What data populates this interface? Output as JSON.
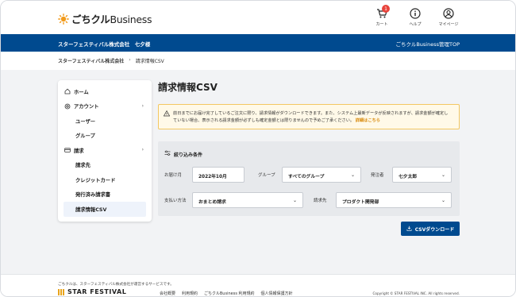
{
  "header": {
    "brand_main": "ごちクル",
    "brand_sub": "Business",
    "cart_label": "カート",
    "cart_count": "1",
    "help_label": "ヘルプ",
    "mypage_label": "マイページ"
  },
  "bluebar": {
    "company": "スターフェスティバル株式会社　七夕様",
    "admin_link": "ごちクルBusiness管理TOP"
  },
  "breadcrumb": {
    "root": "スターフェスティバル株式会社",
    "separator": "›",
    "current": "請求情報CSV"
  },
  "sidebar": {
    "items": [
      {
        "label": "ホーム",
        "icon": "home-icon"
      },
      {
        "label": "アカウント",
        "icon": "gear-icon",
        "chevron": "›"
      },
      {
        "label": "ユーザー"
      },
      {
        "label": "グループ"
      },
      {
        "label": "請求",
        "icon": "card-icon",
        "chevron": "›"
      },
      {
        "label": "請求先"
      },
      {
        "label": "クレジットカード"
      },
      {
        "label": "発行済み請求書"
      },
      {
        "label": "請求情報CSV"
      }
    ]
  },
  "main": {
    "title": "請求情報CSV",
    "notice_text": "前日までにお届け完了しているご注文に限り、請求情報がダウンロードできます。また、システム上最新データが反映されますが、請求金額が確定していない場合、表示される請求金額が必ずしも確定金額とは限りませんので予めご了承ください。",
    "notice_more": "詳細はこちら",
    "filter": {
      "title": "絞り込み条件",
      "delivery_month_label": "お届け月",
      "delivery_month_value": "2022年10月",
      "group_label": "グループ",
      "group_value": "すべてのグループ",
      "orderer_label": "発注者",
      "orderer_value": "七夕太郎",
      "payment_label": "支払い方法",
      "payment_value": "おまとめ請求",
      "billing_label": "請求先",
      "billing_value": "プロダクト開発部",
      "dropdown_glyph": "⌄"
    },
    "download_label": "CSVダウンロード"
  },
  "footer": {
    "note": "ごちクルは、スターフェスティバル株式会社が運営するサービスです。",
    "company_logo_text": "STAR FESTIVAL",
    "links": [
      "会社概要",
      "利用規約",
      "ごちクルBusiness 利用規約",
      "個人情報保護方針"
    ],
    "copyright": "Copyright © STAR FESTIVAL INC. All rights reserved."
  },
  "colors": {
    "brand_blue": "#004a8f",
    "sun_orange": "#f19a1b",
    "badge_red": "#e8433b",
    "notice_bg": "#fff9e8",
    "notice_border": "#f3c761"
  }
}
